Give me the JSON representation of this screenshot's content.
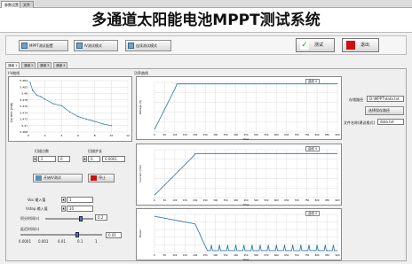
{
  "top_tabs": [
    "参数设置",
    "文件"
  ],
  "title": "多通道太阳能电池MPPT测试系统",
  "toolbar": {
    "buttons": [
      "MPPT测试配置",
      "IV测试模式",
      "连续测试模式"
    ],
    "run": "测试",
    "exit": "退出"
  },
  "sub_tabs": [
    "通道 1",
    "通道 2",
    "通道 3",
    "通道 4"
  ],
  "iv_chart": {
    "label": "I-V曲线",
    "ylabel": "Current (mA)",
    "yticks": [
      "5.484",
      "5.482",
      "5.48",
      "5.478",
      "5.476",
      "5.474",
      "5.472",
      "5.47",
      "5.468"
    ],
    "xticks": [
      "0",
      "2",
      "4",
      "6",
      "8",
      "10",
      "12"
    ]
  },
  "left_ctrls": {
    "labels": [
      "扫描点数",
      "扫描步长"
    ],
    "values": [
      "2",
      "0",
      "0",
      "0.0001"
    ],
    "start_btn": "开始IV测试",
    "stop_btn": "停止",
    "param_labels": [
      "Voc 输入值",
      "Vstep 输入值",
      "积分时间(s)",
      "延迟时间(s)"
    ],
    "param_values": [
      "1",
      "10",
      "0.2"
    ],
    "slider_ticks": [
      "0.0001",
      "0.001",
      "0.01",
      "0.1",
      "1"
    ],
    "slider_value": "0.01"
  },
  "top_chart": {
    "label": "功率曲线",
    "legend": "曲线 0",
    "ylabel": "Voltage (V)",
    "xlabel": "time",
    "xticks": [
      "0",
      "50",
      "100",
      "150",
      "200",
      "250",
      "300",
      "350",
      "400",
      "450",
      "500",
      "550",
      "600",
      "650",
      "700",
      "750",
      "800",
      "850",
      "900"
    ]
  },
  "mid_chart": {
    "legend": "曲线 0",
    "ylabel": "Current (mA)",
    "xlabel": "time",
    "xticks": [
      "0",
      "50",
      "100",
      "150",
      "200",
      "250",
      "300",
      "350",
      "400",
      "450",
      "500",
      "550",
      "600",
      "650",
      "700",
      "750",
      "800",
      "850",
      "900"
    ]
  },
  "bot_chart": {
    "legend": "曲线 0",
    "ylabel": "Power",
    "xlabel": "time",
    "xticks": [
      "0",
      "50",
      "100",
      "150",
      "200",
      "250",
      "300",
      "350",
      "400",
      "450",
      "500",
      "550",
      "600",
      "650",
      "700",
      "750",
      "800",
      "850",
      "900"
    ]
  },
  "right_ctrls": {
    "save_label": "存储路径",
    "save_value": "D:\\MPPT\\data.txt",
    "browse_btn": "选择保存路径",
    "file_label": "文件名称(建议格式)",
    "file_value": "data.txt"
  },
  "colors": {
    "trace": "#1f6fb0",
    "grid": "#c8c8c8"
  }
}
